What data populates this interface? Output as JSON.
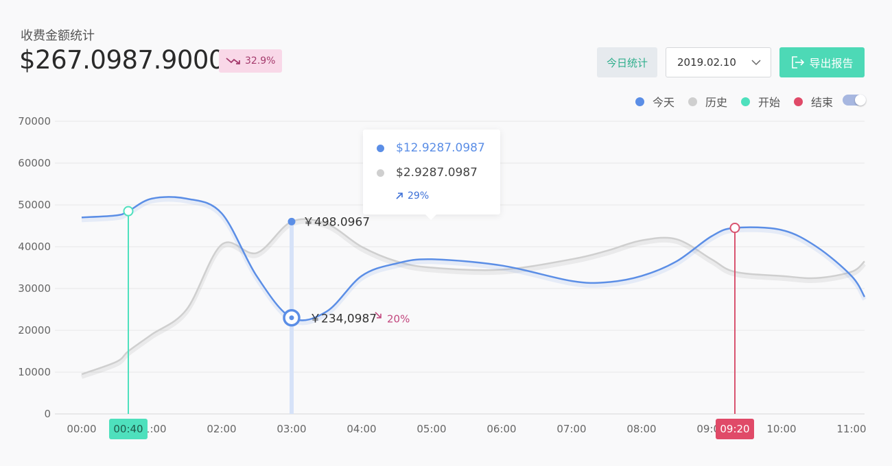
{
  "header": {
    "title": "收费金额统计",
    "amount": "$267.0987.9000",
    "change_badge": "32.9%"
  },
  "toolbar": {
    "today_label": "今日统计",
    "date_value": "2019.02.10",
    "export_label": "导出报告"
  },
  "legend": [
    {
      "label": "今天",
      "color": "#5b8ee6"
    },
    {
      "label": "历史",
      "color": "#cfcfcf"
    },
    {
      "label": "开始",
      "color": "#4ee0bd"
    },
    {
      "label": "结束",
      "color": "#e04a68"
    }
  ],
  "tooltip": {
    "today_value": "$12.9287.0987",
    "history_value": "$2.9287.0987",
    "change": "29%"
  },
  "annotations": {
    "history_point_label": "￥498.0967",
    "today_point_label": "￥234,0987",
    "today_point_change": "20%",
    "start_marker": "00:40",
    "end_marker": "09:20"
  },
  "chart_data": {
    "type": "line",
    "x": [
      "00:00",
      "00:30",
      "00:40",
      "01:00",
      "01:30",
      "02:00",
      "02:30",
      "03:00",
      "03:30",
      "04:00",
      "04:30",
      "05:00",
      "06:00",
      "07:00",
      "07:30",
      "08:00",
      "08:30",
      "09:00",
      "09:20",
      "10:00",
      "10:30",
      "11:00",
      "11:12"
    ],
    "series": [
      {
        "name": "今天",
        "color": "#5b8ee6",
        "values": [
          47000,
          47500,
          48500,
          51500,
          51500,
          48000,
          33000,
          23000,
          24500,
          33000,
          36000,
          37000,
          35500,
          31800,
          31500,
          33000,
          36500,
          42500,
          44500,
          44000,
          40000,
          33000,
          28000
        ]
      },
      {
        "name": "历史",
        "color": "#cfcfcf",
        "values": [
          9500,
          12500,
          15000,
          19000,
          25000,
          40500,
          38500,
          46000,
          45500,
          40000,
          36500,
          35000,
          34500,
          37000,
          39000,
          41500,
          41800,
          37000,
          34000,
          33000,
          32500,
          34000,
          36500
        ]
      }
    ],
    "yticks": [
      0,
      10000,
      20000,
      30000,
      40000,
      50000,
      60000,
      70000
    ],
    "xticks": [
      "00:00",
      "01:00",
      "02:00",
      "03:00",
      "04:00",
      "05:00",
      "06:00",
      "07:00",
      "08:00",
      "09:00",
      "10:00",
      "11:00"
    ],
    "ylim": [
      0,
      70000
    ],
    "grid": true,
    "markers": {
      "start": "00:40",
      "end": "09:20",
      "selected": "03:00"
    }
  }
}
